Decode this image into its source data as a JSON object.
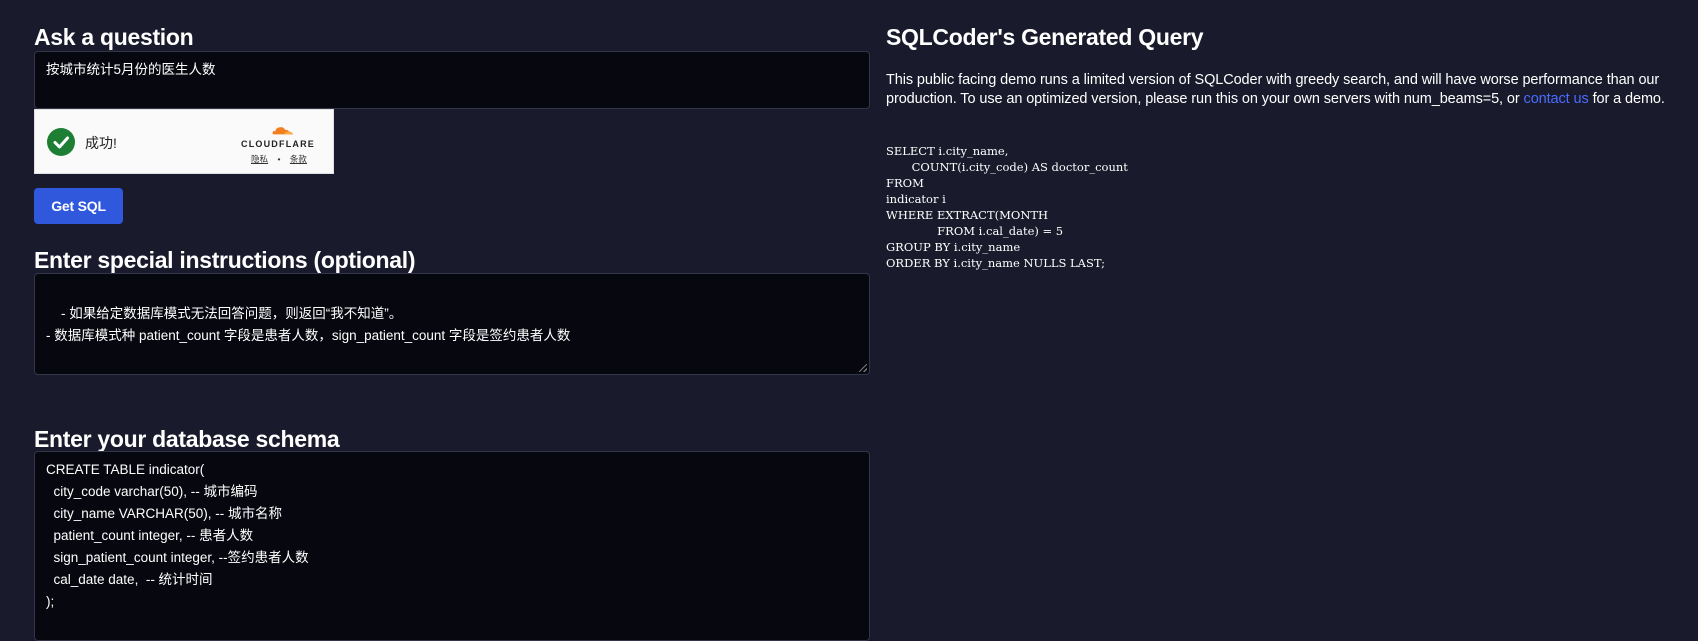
{
  "ask": {
    "heading": "Ask a question",
    "question_value": "按城市统计5月份的医生人数"
  },
  "captcha": {
    "status_text": "成功!",
    "brand": "CLOUDFLARE",
    "privacy_link": "隐私",
    "separator": "•",
    "terms_link": "条款",
    "check_color": "#1e7e34",
    "brand_color": "#f38020"
  },
  "actions": {
    "get_sql_label": "Get SQL",
    "button_color": "#2f58dd"
  },
  "instructions": {
    "heading": "Enter special instructions (optional)",
    "value": "- 如果给定数据库模式无法回答问题，则返回“我不知道”。\n- 数据库模式种 patient_count 字段是患者人数，sign_patient_count 字段是签约患者人数"
  },
  "schema": {
    "heading": "Enter your database schema",
    "value": "CREATE TABLE indicator(\n  city_code varchar(50), -- 城市编码\n  city_name VARCHAR(50), -- 城市名称\n  patient_count integer, -- 患者人数\n  sign_patient_count integer, --签约患者人数\n  cal_date date,  -- 统计时间\n);"
  },
  "result": {
    "heading": "SQLCoder's Generated Query",
    "description_before": "This public facing demo runs a limited version of SQLCoder with greedy search, and will have worse performance than our production. To use an optimized version, please run this on your own servers with num_beams=5, or ",
    "contact_link": "contact us",
    "description_after": " for a demo.",
    "link_color": "#4b6bff",
    "query": "SELECT i.city_name,\n       COUNT(i.city_code) AS doctor_count\nFROM\nindicator i\nWHERE EXTRACT(MONTH\n              FROM i.cal_date) = 5\nGROUP BY i.city_name\nORDER BY i.city_name NULLS LAST;"
  }
}
